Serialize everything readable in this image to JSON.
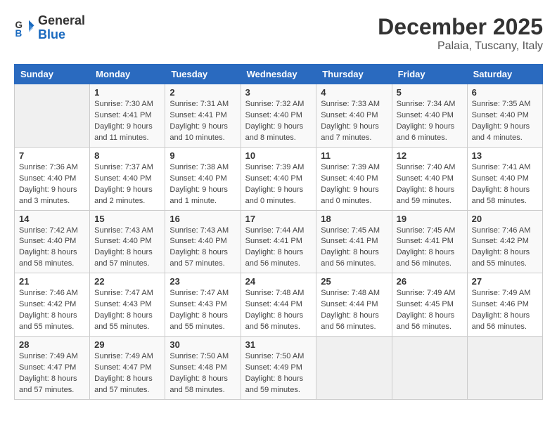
{
  "logo": {
    "line1": "General",
    "line2": "Blue"
  },
  "header": {
    "month": "December 2025",
    "location": "Palaia, Tuscany, Italy"
  },
  "weekdays": [
    "Sunday",
    "Monday",
    "Tuesday",
    "Wednesday",
    "Thursday",
    "Friday",
    "Saturday"
  ],
  "weeks": [
    [
      {
        "day": "",
        "info": ""
      },
      {
        "day": "1",
        "info": "Sunrise: 7:30 AM\nSunset: 4:41 PM\nDaylight: 9 hours\nand 11 minutes."
      },
      {
        "day": "2",
        "info": "Sunrise: 7:31 AM\nSunset: 4:41 PM\nDaylight: 9 hours\nand 10 minutes."
      },
      {
        "day": "3",
        "info": "Sunrise: 7:32 AM\nSunset: 4:40 PM\nDaylight: 9 hours\nand 8 minutes."
      },
      {
        "day": "4",
        "info": "Sunrise: 7:33 AM\nSunset: 4:40 PM\nDaylight: 9 hours\nand 7 minutes."
      },
      {
        "day": "5",
        "info": "Sunrise: 7:34 AM\nSunset: 4:40 PM\nDaylight: 9 hours\nand 6 minutes."
      },
      {
        "day": "6",
        "info": "Sunrise: 7:35 AM\nSunset: 4:40 PM\nDaylight: 9 hours\nand 4 minutes."
      }
    ],
    [
      {
        "day": "7",
        "info": "Sunrise: 7:36 AM\nSunset: 4:40 PM\nDaylight: 9 hours\nand 3 minutes."
      },
      {
        "day": "8",
        "info": "Sunrise: 7:37 AM\nSunset: 4:40 PM\nDaylight: 9 hours\nand 2 minutes."
      },
      {
        "day": "9",
        "info": "Sunrise: 7:38 AM\nSunset: 4:40 PM\nDaylight: 9 hours\nand 1 minute."
      },
      {
        "day": "10",
        "info": "Sunrise: 7:39 AM\nSunset: 4:40 PM\nDaylight: 9 hours\nand 0 minutes."
      },
      {
        "day": "11",
        "info": "Sunrise: 7:39 AM\nSunset: 4:40 PM\nDaylight: 9 hours\nand 0 minutes."
      },
      {
        "day": "12",
        "info": "Sunrise: 7:40 AM\nSunset: 4:40 PM\nDaylight: 8 hours\nand 59 minutes."
      },
      {
        "day": "13",
        "info": "Sunrise: 7:41 AM\nSunset: 4:40 PM\nDaylight: 8 hours\nand 58 minutes."
      }
    ],
    [
      {
        "day": "14",
        "info": "Sunrise: 7:42 AM\nSunset: 4:40 PM\nDaylight: 8 hours\nand 58 minutes."
      },
      {
        "day": "15",
        "info": "Sunrise: 7:43 AM\nSunset: 4:40 PM\nDaylight: 8 hours\nand 57 minutes."
      },
      {
        "day": "16",
        "info": "Sunrise: 7:43 AM\nSunset: 4:40 PM\nDaylight: 8 hours\nand 57 minutes."
      },
      {
        "day": "17",
        "info": "Sunrise: 7:44 AM\nSunset: 4:41 PM\nDaylight: 8 hours\nand 56 minutes."
      },
      {
        "day": "18",
        "info": "Sunrise: 7:45 AM\nSunset: 4:41 PM\nDaylight: 8 hours\nand 56 minutes."
      },
      {
        "day": "19",
        "info": "Sunrise: 7:45 AM\nSunset: 4:41 PM\nDaylight: 8 hours\nand 56 minutes."
      },
      {
        "day": "20",
        "info": "Sunrise: 7:46 AM\nSunset: 4:42 PM\nDaylight: 8 hours\nand 55 minutes."
      }
    ],
    [
      {
        "day": "21",
        "info": "Sunrise: 7:46 AM\nSunset: 4:42 PM\nDaylight: 8 hours\nand 55 minutes."
      },
      {
        "day": "22",
        "info": "Sunrise: 7:47 AM\nSunset: 4:43 PM\nDaylight: 8 hours\nand 55 minutes."
      },
      {
        "day": "23",
        "info": "Sunrise: 7:47 AM\nSunset: 4:43 PM\nDaylight: 8 hours\nand 55 minutes."
      },
      {
        "day": "24",
        "info": "Sunrise: 7:48 AM\nSunset: 4:44 PM\nDaylight: 8 hours\nand 56 minutes."
      },
      {
        "day": "25",
        "info": "Sunrise: 7:48 AM\nSunset: 4:44 PM\nDaylight: 8 hours\nand 56 minutes."
      },
      {
        "day": "26",
        "info": "Sunrise: 7:49 AM\nSunset: 4:45 PM\nDaylight: 8 hours\nand 56 minutes."
      },
      {
        "day": "27",
        "info": "Sunrise: 7:49 AM\nSunset: 4:46 PM\nDaylight: 8 hours\nand 56 minutes."
      }
    ],
    [
      {
        "day": "28",
        "info": "Sunrise: 7:49 AM\nSunset: 4:47 PM\nDaylight: 8 hours\nand 57 minutes."
      },
      {
        "day": "29",
        "info": "Sunrise: 7:49 AM\nSunset: 4:47 PM\nDaylight: 8 hours\nand 57 minutes."
      },
      {
        "day": "30",
        "info": "Sunrise: 7:50 AM\nSunset: 4:48 PM\nDaylight: 8 hours\nand 58 minutes."
      },
      {
        "day": "31",
        "info": "Sunrise: 7:50 AM\nSunset: 4:49 PM\nDaylight: 8 hours\nand 59 minutes."
      },
      {
        "day": "",
        "info": ""
      },
      {
        "day": "",
        "info": ""
      },
      {
        "day": "",
        "info": ""
      }
    ]
  ]
}
